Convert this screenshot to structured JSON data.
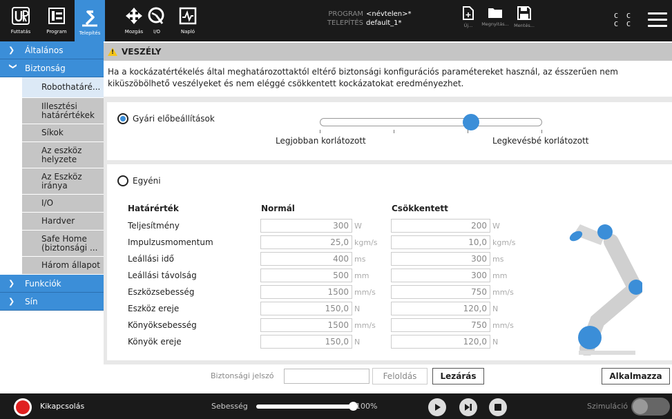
{
  "header": {
    "nav": [
      {
        "label": "Futtatás",
        "icon": "ur-logo-icon"
      },
      {
        "label": "Program",
        "icon": "program-icon"
      },
      {
        "label": "Telepítés",
        "icon": "installation-icon",
        "active": true
      },
      {
        "label": "Mozgás",
        "icon": "move-icon"
      },
      {
        "label": "I/O",
        "icon": "io-icon"
      },
      {
        "label": "Napló",
        "icon": "log-icon"
      }
    ],
    "program_key": "PROGRAM",
    "program_value": "<névtelen>*",
    "install_key": "TELEPÍTÉS",
    "install_value": "default_1*",
    "files": [
      {
        "label": "Új...",
        "icon": "new-file-icon"
      },
      {
        "label": "Megnyitás...",
        "icon": "folder-icon"
      },
      {
        "label": "Mentés...",
        "icon": "save-icon"
      }
    ],
    "cc_line1": "C C",
    "cc_line2": "C C"
  },
  "sidebar": {
    "sections": {
      "general": "Általános",
      "safety": "Biztonság",
      "features": "Funkciók",
      "track": "Sín"
    },
    "items": [
      {
        "label": "Robothatáré...",
        "selected": true
      },
      {
        "label": "Illesztési határértékek"
      },
      {
        "label": "Síkok"
      },
      {
        "label": "Az eszköz helyzete"
      },
      {
        "label": "Az Eszköz iránya"
      },
      {
        "label": "I/O"
      },
      {
        "label": "Hardver"
      },
      {
        "label": "Safe Home (biztonsági ..."
      },
      {
        "label": "Három állapot"
      }
    ]
  },
  "warning": {
    "title": "VESZÉLY",
    "text": "Ha a kockázatértékelés által meghatározottaktól eltérő biztonsági konfigurációs paramétereket használ, az ésszerűen nem kiküszöbölhető veszélyeket és nem eléggé csökkentett kockázatokat eredményezhet."
  },
  "factory": {
    "label": "Gyári előbeállítások",
    "slider_left": "Legjobban korlátozott",
    "slider_right": "Legkevésbé korlátozott",
    "slider_position": 0.68
  },
  "custom": {
    "label": "Egyéni",
    "col_limit": "Határérték",
    "col_normal": "Normál",
    "col_reduced": "Csökkentett",
    "rows": [
      {
        "label": "Teljesítmény",
        "normal": "300",
        "reduced": "200",
        "unit": "W"
      },
      {
        "label": "Impulzusmomentum",
        "normal": "25,0",
        "reduced": "10,0",
        "unit": "kgm/s"
      },
      {
        "label": "Leállási idő",
        "normal": "400",
        "reduced": "300",
        "unit": "ms"
      },
      {
        "label": "Leállási távolság",
        "normal": "500",
        "reduced": "300",
        "unit": "mm"
      },
      {
        "label": "Eszközsebesség",
        "normal": "1500",
        "reduced": "750",
        "unit": "mm/s"
      },
      {
        "label": "Eszköz ereje",
        "normal": "150,0",
        "reduced": "120,0",
        "unit": "N"
      },
      {
        "label": "Könyöksebesség",
        "normal": "1500",
        "reduced": "750",
        "unit": "mm/s"
      },
      {
        "label": "Könyök ereje",
        "normal": "150,0",
        "reduced": "120,0",
        "unit": "N"
      }
    ]
  },
  "actions": {
    "password_label": "Biztonsági jelszó",
    "unlock": "Feloldás",
    "lock": "Lezárás",
    "apply": "Alkalmazza"
  },
  "footer": {
    "power_label": "Kikapcsolás",
    "speed_label": "Sebesség",
    "speed_value": "100%",
    "speed_fraction": 1.0,
    "simulation_label": "Szimuláció"
  },
  "colors": {
    "accent": "#3b8ed8",
    "header_bg": "#1a1a1a",
    "warning": "#f5c518",
    "power": "#e02020"
  }
}
